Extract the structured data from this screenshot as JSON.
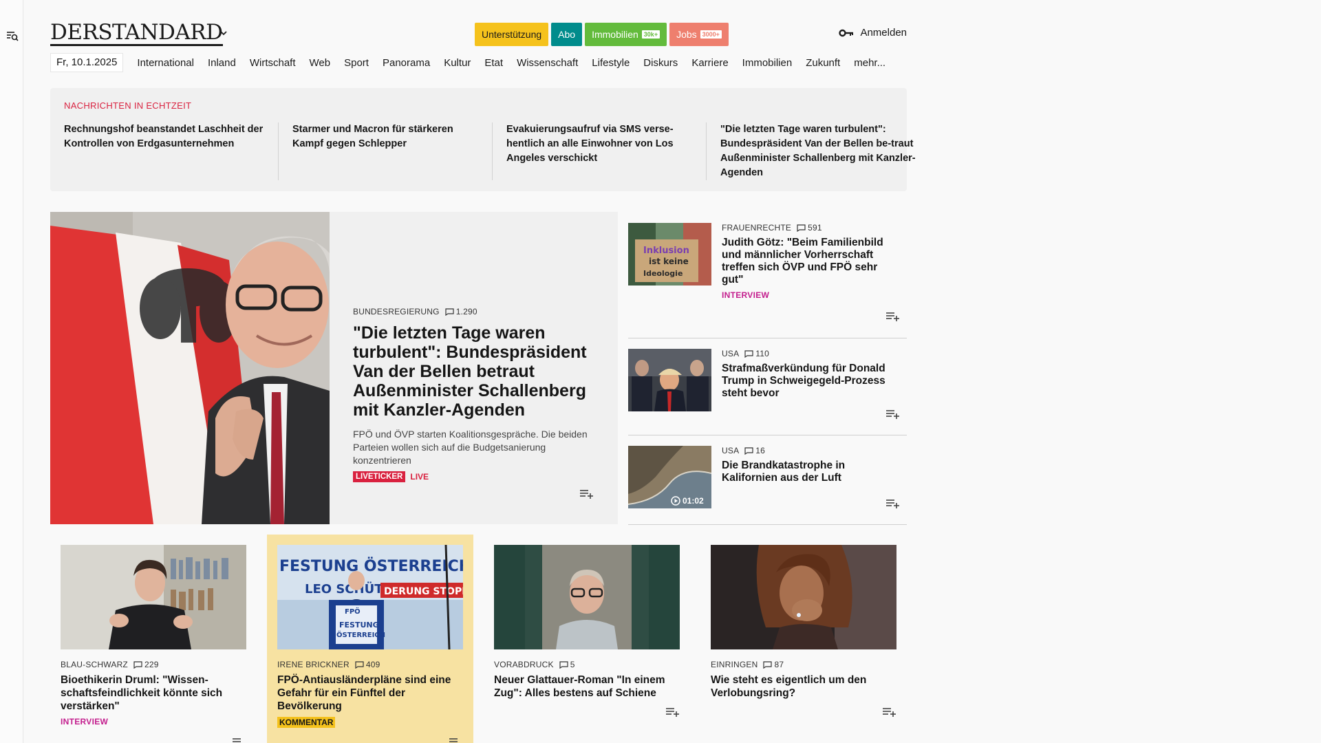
{
  "brand": {
    "logo": "DERSTANDARD"
  },
  "header": {
    "buttons": [
      {
        "label": "Unterstützung",
        "badge": ""
      },
      {
        "label": "Abo",
        "badge": ""
      },
      {
        "label": "Immobilien",
        "badge": "30k+"
      },
      {
        "label": "Jobs",
        "badge": "3000+"
      }
    ],
    "login_label": "Anmelden"
  },
  "nav": {
    "date": "Fr, 10.1.2025",
    "items": [
      "International",
      "Inland",
      "Wirtschaft",
      "Web",
      "Sport",
      "Panorama",
      "Kultur",
      "Etat",
      "Wissenschaft",
      "Lifestyle",
      "Diskurs",
      "Karriere",
      "Immobilien",
      "Zukunft",
      "mehr..."
    ]
  },
  "ticker": {
    "title": "NACHRICHTEN IN ECHTZEIT",
    "items": [
      "Rechnungshof beanstandet Laschheit der Kontrollen von Erdgasunternehmen",
      "Starmer und Macron für stärkeren Kampf gegen Schlepper",
      "Evakuierungsaufruf via SMS verse-hentlich an alle Einwohner von Los Angeles verschickt",
      "\"Die letzten Tage waren turbulent\": Bundespräsident Van der Bellen be-traut Außenminister Schallenberg mit Kanzler-Agenden"
    ]
  },
  "main_story": {
    "kicker": "BUNDESREGIERUNG",
    "comments": "1.290",
    "headline": "\"Die letzten Tage waren turbulent\": Bundespräsident Van der Bellen betraut Außenminister Schallenberg mit Kanzler-Agenden",
    "teaser": "FPÖ und ÖVP starten Koalitionsgespräche. Die beiden Parteien wollen sich auf die Budgetsanierung konzentrieren",
    "liveticker": "LIVETICKER",
    "live": "LIVE"
  },
  "side_stories": [
    {
      "kicker": "FRAUENRECHTE",
      "comments": "591",
      "headline": "Judith Götz: \"Beim Familienbild und männlicher Vorherrschaft treffen sich ÖVP und FPÖ sehr gut\"",
      "tag": "INTERVIEW",
      "video": ""
    },
    {
      "kicker": "USA",
      "comments": "110",
      "headline": "Strafmaßverkündung für Donald Trump in Schweigegeld-Prozess steht bevor",
      "tag": "",
      "video": ""
    },
    {
      "kicker": "USA",
      "comments": "16",
      "headline": "Die Brandkatastrophe in Kalifornien aus der Luft",
      "tag": "",
      "video": "01:02"
    }
  ],
  "cards": [
    {
      "kicker": "BLAU-SCHWARZ",
      "comments": "229",
      "headline": "Bioethikerin Druml: \"Wissen-schaftsfeindlichkeit könnte sich verstärken\"",
      "tag": "INTERVIEW"
    },
    {
      "kicker": "IRENE BRICKNER",
      "comments": "409",
      "headline": "FPÖ-Antiausländerpläne sind eine Gefahr für ein Fünftel der Bevölkerung",
      "tag": "KOMMENTAR"
    },
    {
      "kicker": "VORABDRUCK",
      "comments": "5",
      "headline": "Neuer Glattauer-Roman \"In einem Zug\": Alles bestens auf Schiene",
      "tag": ""
    },
    {
      "kicker": "EINRINGEN",
      "comments": "87",
      "headline": "Wie steht es eigentlich um den Verlobungsring?",
      "tag": ""
    }
  ],
  "image_texts": {
    "sign_line1": "Inklusion",
    "sign_line2": "ist keine",
    "sign_line3": "Ideologie",
    "banner1": "FESTUNG ÖSTERREICH",
    "banner2": "LEO   SCHÜTZEN",
    "banner3": "DERUNG STOPPEN",
    "podium1": "FPÖ",
    "podium2": "FESTUNG",
    "podium3": "ÖSTERREICH"
  },
  "colors": {
    "accent_red": "#d9213f",
    "interview_magenta": "#c31d8d",
    "unterstuetzung": "#f5c21c",
    "abo": "#008c8c",
    "immobilien": "#63bb3c",
    "jobs": "#ee7f6e",
    "highlight_card": "#f7e2a2"
  },
  "icons": [
    "search-menu-icon",
    "chevron-down-icon",
    "key-icon",
    "comment-icon",
    "add-to-list-icon",
    "play-icon"
  ]
}
